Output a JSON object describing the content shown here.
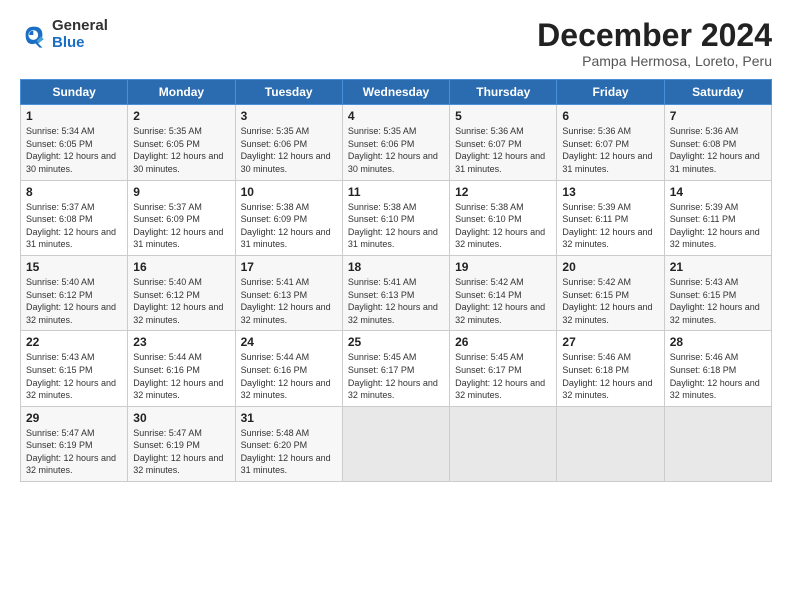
{
  "logo": {
    "general": "General",
    "blue": "Blue"
  },
  "title": "December 2024",
  "subtitle": "Pampa Hermosa, Loreto, Peru",
  "days_of_week": [
    "Sunday",
    "Monday",
    "Tuesday",
    "Wednesday",
    "Thursday",
    "Friday",
    "Saturday"
  ],
  "weeks": [
    [
      {
        "day": "1",
        "sunrise": "5:34 AM",
        "sunset": "6:05 PM",
        "daylight": "12 hours and 30 minutes."
      },
      {
        "day": "2",
        "sunrise": "5:35 AM",
        "sunset": "6:05 PM",
        "daylight": "12 hours and 30 minutes."
      },
      {
        "day": "3",
        "sunrise": "5:35 AM",
        "sunset": "6:06 PM",
        "daylight": "12 hours and 30 minutes."
      },
      {
        "day": "4",
        "sunrise": "5:35 AM",
        "sunset": "6:06 PM",
        "daylight": "12 hours and 30 minutes."
      },
      {
        "day": "5",
        "sunrise": "5:36 AM",
        "sunset": "6:07 PM",
        "daylight": "12 hours and 31 minutes."
      },
      {
        "day": "6",
        "sunrise": "5:36 AM",
        "sunset": "6:07 PM",
        "daylight": "12 hours and 31 minutes."
      },
      {
        "day": "7",
        "sunrise": "5:36 AM",
        "sunset": "6:08 PM",
        "daylight": "12 hours and 31 minutes."
      }
    ],
    [
      {
        "day": "8",
        "sunrise": "5:37 AM",
        "sunset": "6:08 PM",
        "daylight": "12 hours and 31 minutes."
      },
      {
        "day": "9",
        "sunrise": "5:37 AM",
        "sunset": "6:09 PM",
        "daylight": "12 hours and 31 minutes."
      },
      {
        "day": "10",
        "sunrise": "5:38 AM",
        "sunset": "6:09 PM",
        "daylight": "12 hours and 31 minutes."
      },
      {
        "day": "11",
        "sunrise": "5:38 AM",
        "sunset": "6:10 PM",
        "daylight": "12 hours and 31 minutes."
      },
      {
        "day": "12",
        "sunrise": "5:38 AM",
        "sunset": "6:10 PM",
        "daylight": "12 hours and 32 minutes."
      },
      {
        "day": "13",
        "sunrise": "5:39 AM",
        "sunset": "6:11 PM",
        "daylight": "12 hours and 32 minutes."
      },
      {
        "day": "14",
        "sunrise": "5:39 AM",
        "sunset": "6:11 PM",
        "daylight": "12 hours and 32 minutes."
      }
    ],
    [
      {
        "day": "15",
        "sunrise": "5:40 AM",
        "sunset": "6:12 PM",
        "daylight": "12 hours and 32 minutes."
      },
      {
        "day": "16",
        "sunrise": "5:40 AM",
        "sunset": "6:12 PM",
        "daylight": "12 hours and 32 minutes."
      },
      {
        "day": "17",
        "sunrise": "5:41 AM",
        "sunset": "6:13 PM",
        "daylight": "12 hours and 32 minutes."
      },
      {
        "day": "18",
        "sunrise": "5:41 AM",
        "sunset": "6:13 PM",
        "daylight": "12 hours and 32 minutes."
      },
      {
        "day": "19",
        "sunrise": "5:42 AM",
        "sunset": "6:14 PM",
        "daylight": "12 hours and 32 minutes."
      },
      {
        "day": "20",
        "sunrise": "5:42 AM",
        "sunset": "6:15 PM",
        "daylight": "12 hours and 32 minutes."
      },
      {
        "day": "21",
        "sunrise": "5:43 AM",
        "sunset": "6:15 PM",
        "daylight": "12 hours and 32 minutes."
      }
    ],
    [
      {
        "day": "22",
        "sunrise": "5:43 AM",
        "sunset": "6:15 PM",
        "daylight": "12 hours and 32 minutes."
      },
      {
        "day": "23",
        "sunrise": "5:44 AM",
        "sunset": "6:16 PM",
        "daylight": "12 hours and 32 minutes."
      },
      {
        "day": "24",
        "sunrise": "5:44 AM",
        "sunset": "6:16 PM",
        "daylight": "12 hours and 32 minutes."
      },
      {
        "day": "25",
        "sunrise": "5:45 AM",
        "sunset": "6:17 PM",
        "daylight": "12 hours and 32 minutes."
      },
      {
        "day": "26",
        "sunrise": "5:45 AM",
        "sunset": "6:17 PM",
        "daylight": "12 hours and 32 minutes."
      },
      {
        "day": "27",
        "sunrise": "5:46 AM",
        "sunset": "6:18 PM",
        "daylight": "12 hours and 32 minutes."
      },
      {
        "day": "28",
        "sunrise": "5:46 AM",
        "sunset": "6:18 PM",
        "daylight": "12 hours and 32 minutes."
      }
    ],
    [
      {
        "day": "29",
        "sunrise": "5:47 AM",
        "sunset": "6:19 PM",
        "daylight": "12 hours and 32 minutes."
      },
      {
        "day": "30",
        "sunrise": "5:47 AM",
        "sunset": "6:19 PM",
        "daylight": "12 hours and 32 minutes."
      },
      {
        "day": "31",
        "sunrise": "5:48 AM",
        "sunset": "6:20 PM",
        "daylight": "12 hours and 31 minutes."
      },
      null,
      null,
      null,
      null
    ]
  ]
}
